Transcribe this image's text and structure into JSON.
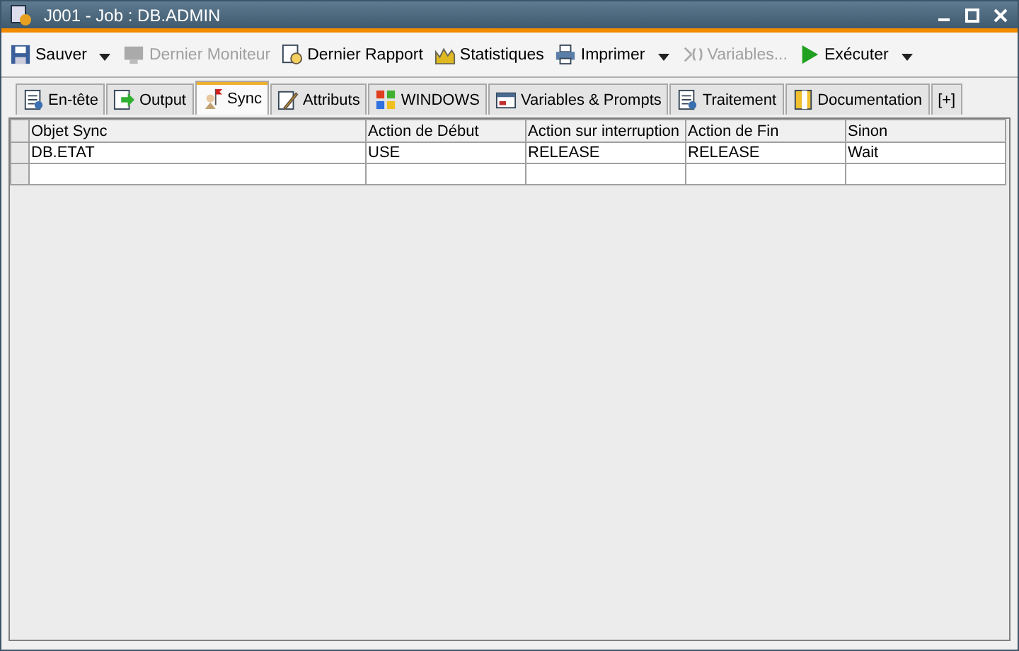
{
  "window": {
    "title": "J001 - Job : DB.ADMIN"
  },
  "toolbar": [
    {
      "label": "Sauver",
      "disabled": false,
      "dropdown": true
    },
    {
      "label": "Dernier Moniteur",
      "disabled": true,
      "dropdown": false
    },
    {
      "label": "Dernier Rapport",
      "disabled": false,
      "dropdown": false
    },
    {
      "label": "Statistiques",
      "disabled": false,
      "dropdown": false
    },
    {
      "label": "Imprimer",
      "disabled": false,
      "dropdown": true
    },
    {
      "label": "Variables...",
      "disabled": true,
      "dropdown": false
    },
    {
      "label": "Exécuter",
      "disabled": false,
      "dropdown": true
    }
  ],
  "tabs": [
    {
      "label": "En-tête",
      "selected": false
    },
    {
      "label": "Output",
      "selected": false
    },
    {
      "label": "Sync",
      "selected": true
    },
    {
      "label": "Attributs",
      "selected": false
    },
    {
      "label": "WINDOWS",
      "selected": false
    },
    {
      "label": "Variables & Prompts",
      "selected": false
    },
    {
      "label": "Traitement",
      "selected": false
    },
    {
      "label": "Documentation",
      "selected": false
    },
    {
      "label": "[+]",
      "selected": false
    }
  ],
  "table": {
    "columns": [
      "Objet Sync",
      "Action de Début",
      "Action sur interruption",
      "Action de Fin",
      "Sinon"
    ],
    "rows": [
      [
        "DB.ETAT",
        "USE",
        "RELEASE",
        "RELEASE",
        "Wait"
      ]
    ]
  }
}
